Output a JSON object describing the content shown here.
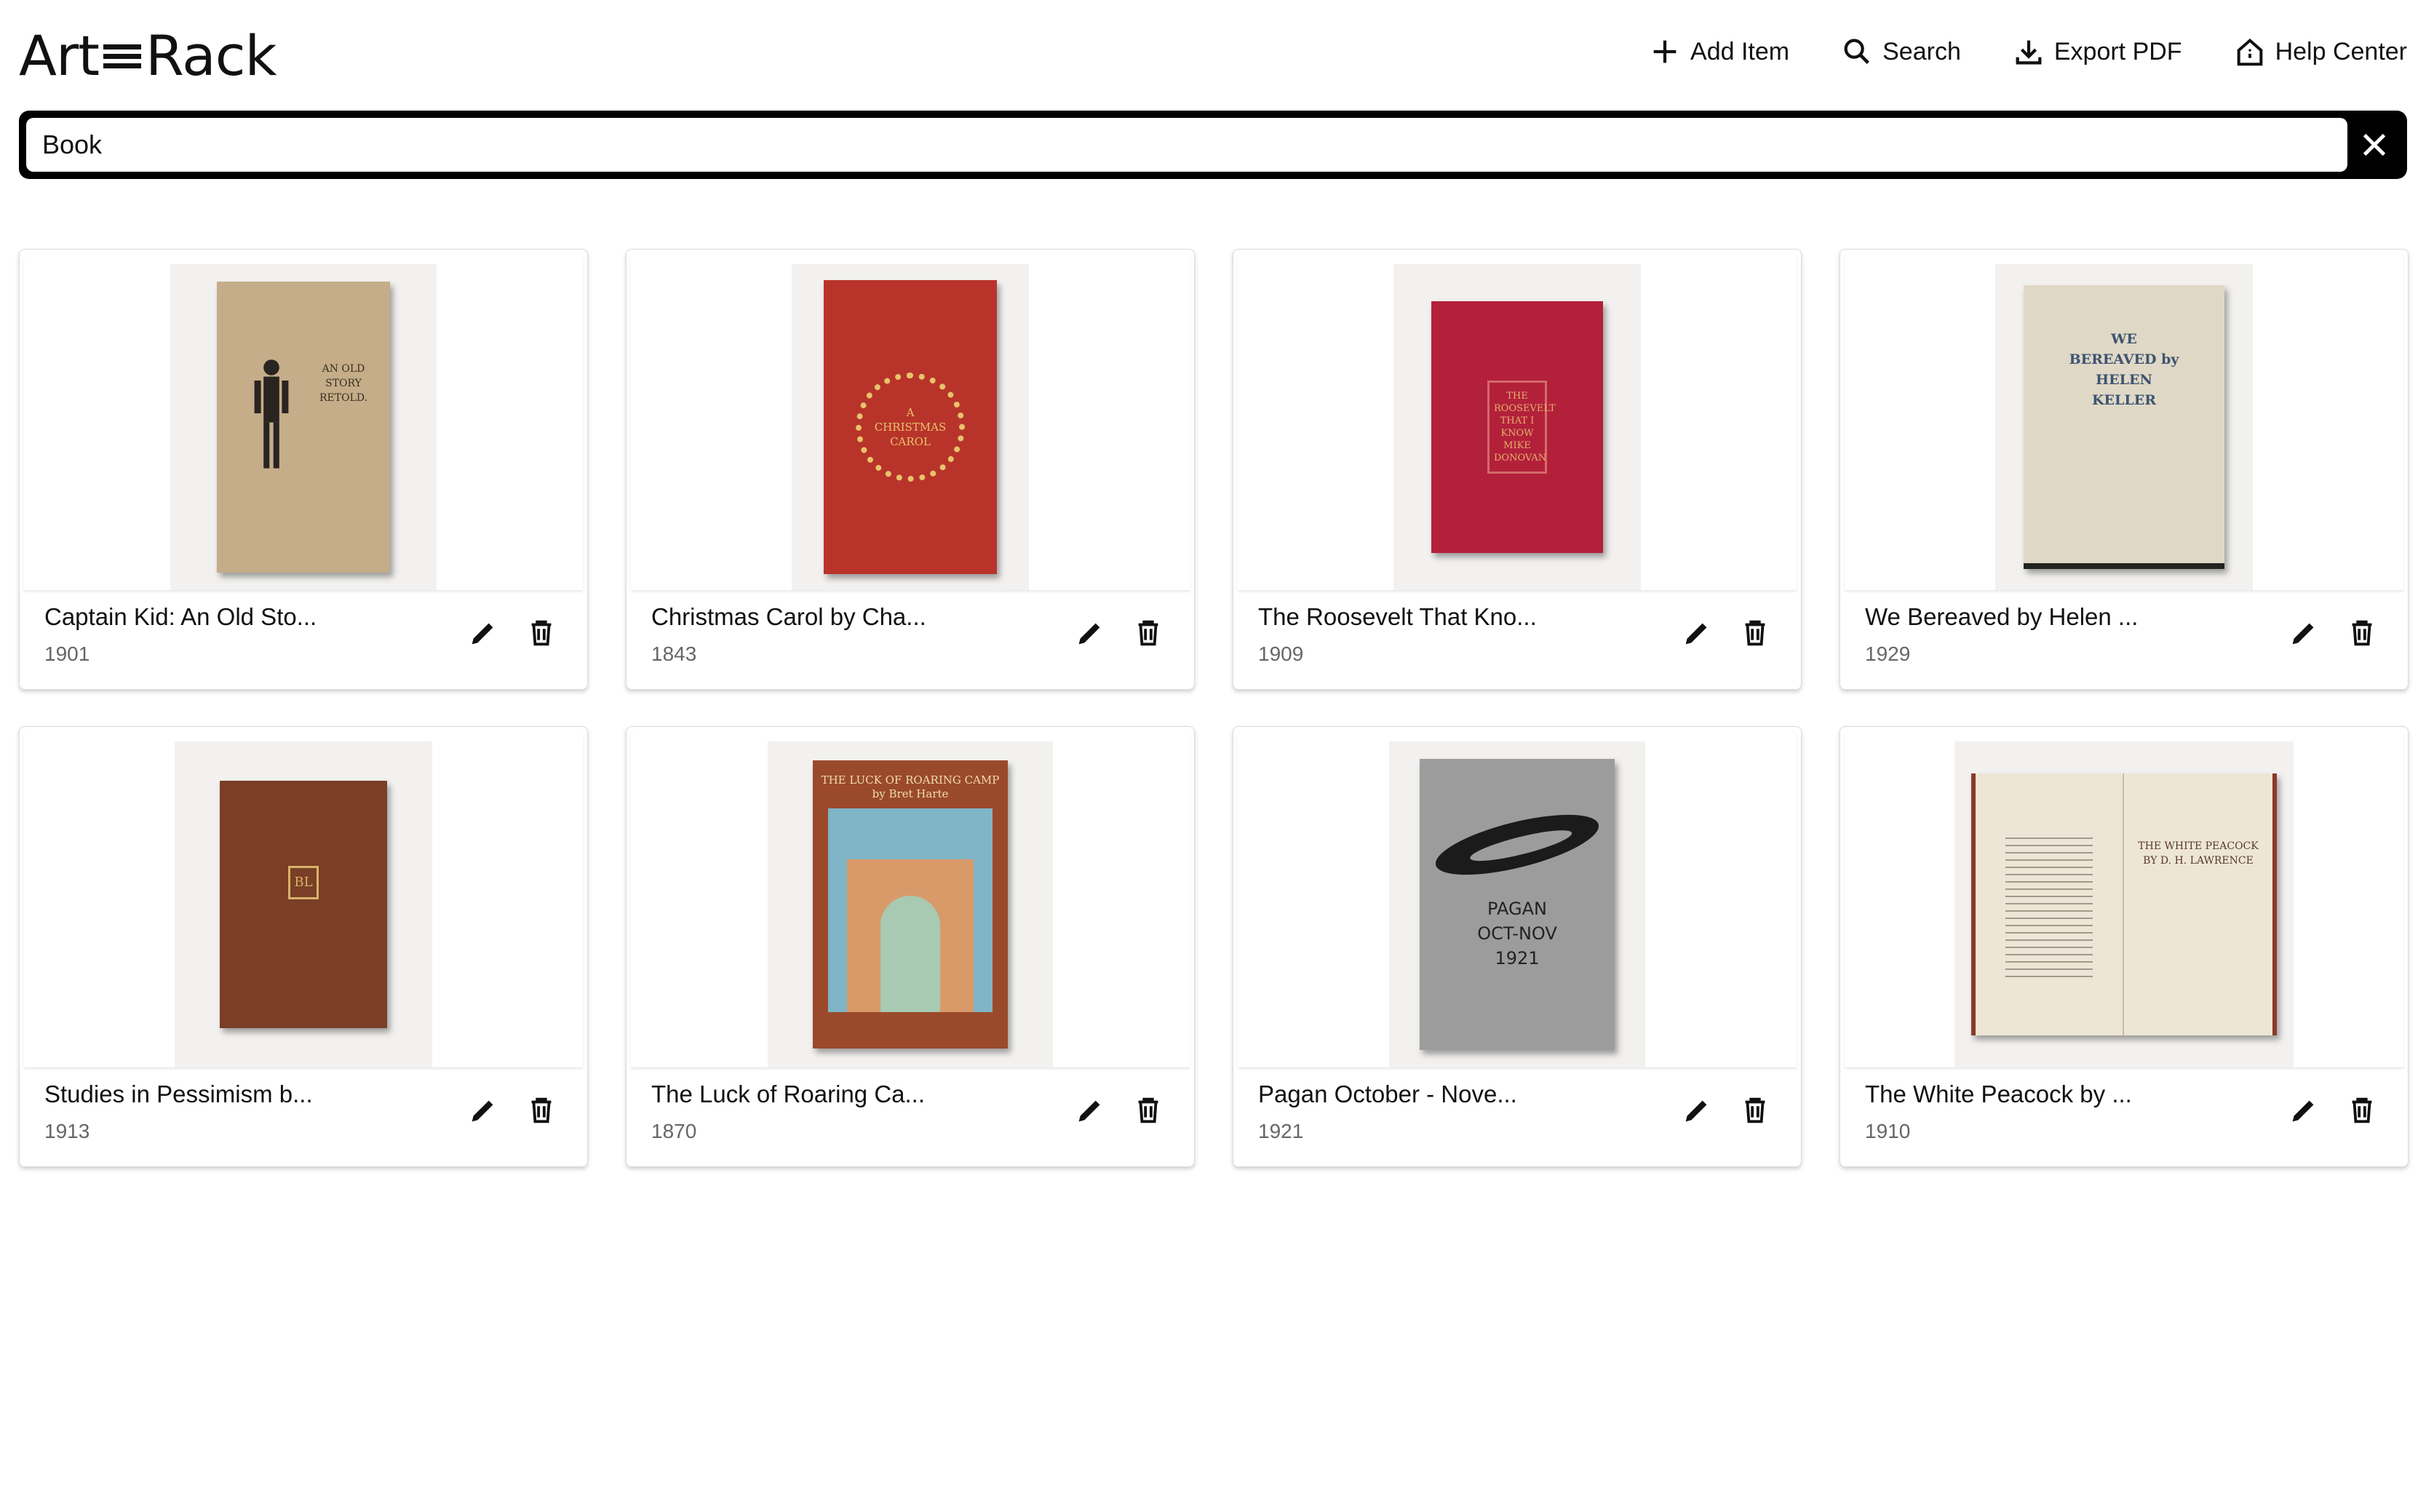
{
  "app": {
    "logo_left": "Art",
    "logo_right": "Rack"
  },
  "nav": [
    {
      "label": "Add Item",
      "icon": "plus-icon"
    },
    {
      "label": "Search",
      "icon": "search-icon"
    },
    {
      "label": "Export PDF",
      "icon": "download-icon"
    },
    {
      "label": "Help Center",
      "icon": "home-icon"
    }
  ],
  "search": {
    "value": "Book"
  },
  "items": [
    {
      "title": "Captain Kid: An Old Sto...",
      "year": "1901",
      "cover_text": "AN OLD STORY RETOLD.",
      "cover_color": "#c4ad88",
      "text_color": "#3a2e22"
    },
    {
      "title": "Christmas Carol by Cha...",
      "year": "1843",
      "cover_text": "A CHRISTMAS CAROL",
      "cover_color": "#b8342b",
      "text_color": "#e7c46a"
    },
    {
      "title": "The Roosevelt That Kno...",
      "year": "1909",
      "cover_text": "THE ROOSEVELT THAT I KNOW MIKE DONOVAN",
      "cover_color": "#b3203a",
      "text_color": "#e3b06a"
    },
    {
      "title": "We Bereaved by Helen ...",
      "year": "1929",
      "cover_text": "WE BEREAVED by HELEN KELLER",
      "cover_color": "#e0d8c6",
      "text_color": "#3c5470"
    },
    {
      "title": "Studies in Pessimism b...",
      "year": "1913",
      "cover_text": "BL",
      "cover_color": "#7a3f26",
      "text_color": "#d8b26a"
    },
    {
      "title": "The Luck of Roaring Ca...",
      "year": "1870",
      "cover_text": "THE LUCK OF ROARING CAMP by Bret Harte",
      "cover_color": "#9a4a2a",
      "text_color": "#f0dcb0"
    },
    {
      "title": "Pagan October - Nove...",
      "year": "1921",
      "cover_text": "PAGAN OCT-NOV 1921",
      "cover_color": "#9c9c9c",
      "text_color": "#222222"
    },
    {
      "title": "The White Peacock by ...",
      "year": "1910",
      "cover_text": "THE WHITE PEACOCK BY D. H. LAWRENCE",
      "cover_color": "#ede6d6",
      "text_color": "#5a3a2a"
    }
  ]
}
